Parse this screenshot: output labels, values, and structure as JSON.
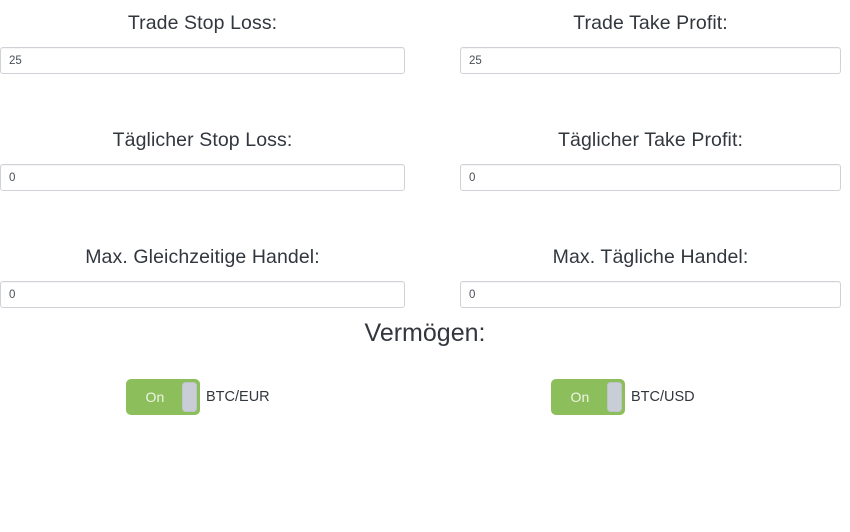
{
  "form": {
    "fields": [
      {
        "id": "trade-stop-loss",
        "label": "Trade Stop Loss:",
        "value": "25",
        "placeholder": ""
      },
      {
        "id": "trade-take-profit",
        "label": "Trade Take Profit:",
        "value": "25",
        "placeholder": ""
      },
      {
        "id": "daily-stop-loss",
        "label": "Täglicher Stop Loss:",
        "value": "0",
        "placeholder": ""
      },
      {
        "id": "daily-take-profit",
        "label": "Täglicher Take Profit:",
        "value": "0",
        "placeholder": ""
      },
      {
        "id": "max-concurrent-trades",
        "label": "Max. Gleichzeitige Handel:",
        "value": "0",
        "placeholder": ""
      },
      {
        "id": "max-daily-trades",
        "label": "Max. Tägliche Handel:",
        "value": "0",
        "placeholder": ""
      }
    ]
  },
  "assets": {
    "heading": "Vermögen:",
    "toggles": [
      {
        "id": "btc-eur",
        "state_label": "On",
        "pair": "BTC/EUR",
        "enabled": true
      },
      {
        "id": "btc-usd",
        "state_label": "On",
        "pair": "BTC/USD",
        "enabled": true
      }
    ]
  },
  "colors": {
    "toggle_on": "#8cbf5b",
    "toggle_handle": "#c9ced6",
    "text": "#32373e",
    "input_border": "#cfd3d8"
  }
}
